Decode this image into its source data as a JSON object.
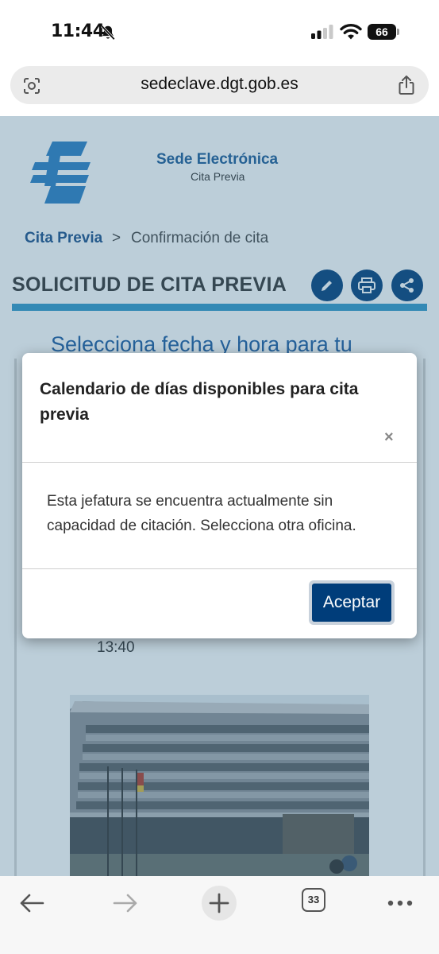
{
  "status_bar": {
    "time": "11:44",
    "battery": "66"
  },
  "browser": {
    "url": "sedeclave.dgt.gob.es",
    "tab_count": "33"
  },
  "header": {
    "site_title": "Sede Electrónica",
    "site_subtitle": "Cita Previa"
  },
  "breadcrumb": {
    "home": "Cita Previa",
    "separator": ">",
    "current": "Confirmación de cita"
  },
  "section": {
    "title": "SOLICITUD DE CITA PREVIA",
    "subheading": "Selecciona fecha y hora para tu"
  },
  "background_content": {
    "time": "13:40"
  },
  "modal": {
    "title": "Calendario de días disponibles para cita previa",
    "close": "×",
    "message": "Esta jefatura se encuentra actualmente sin capacidad de citación. Selecciona otra oficina.",
    "accept_label": "Aceptar"
  },
  "icons": {
    "bell": "bell-slash-icon",
    "edit": "pencil-icon",
    "print": "printer-icon",
    "share": "share-icon",
    "back": "arrow-left-icon",
    "forward": "arrow-right-icon",
    "new_tab": "plus-icon",
    "more": "ellipsis-icon"
  },
  "colors": {
    "brand_blue": "#003d7a",
    "rule_blue": "#2f97c9",
    "link_blue": "#1a4f8a"
  }
}
